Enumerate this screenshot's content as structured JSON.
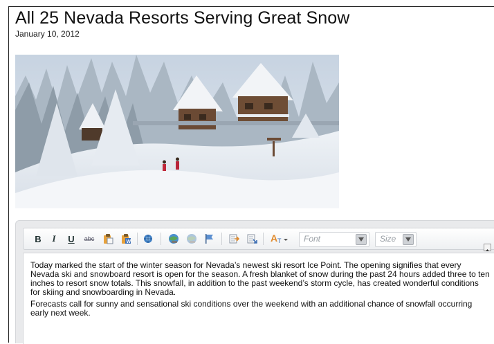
{
  "article": {
    "title": "All 25 Nevada Resorts Serving Great Snow",
    "date": "January 10, 2012"
  },
  "toolbar": {
    "bold_label": "B",
    "italic_label": "I",
    "underline_label": "U",
    "strike_label": "abc",
    "font_placeholder": "Font",
    "size_placeholder": "Size",
    "icons": [
      "paste-icon",
      "paste-word-icon",
      "spellcheck-icon",
      "insert-link-icon",
      "unlink-icon",
      "anchor-flag-icon",
      "indent-icon",
      "outdent-icon",
      "text-color-icon"
    ]
  },
  "content": {
    "paragraphs": [
      "Today marked the start of the winter season for Nevada’s newest ski resort Ice Point. The opening signifies that every Nevada ski and snowboard resort is open for the season. A fresh blanket of snow during the past 24 hours added three to ten inches to resort snow totals. This snowfall, in addition to the past weekend’s storm cycle, has created wonderful conditions for skiing and snowboarding in Nevada.",
      "Forecasts call for sunny and sensational ski conditions over the weekend with an additional chance of snowfall occurring early next week."
    ]
  },
  "colors": {
    "editor_bg": "#e9eaec",
    "toolbar_text": "#233333",
    "sky": "#cfd9e6"
  }
}
